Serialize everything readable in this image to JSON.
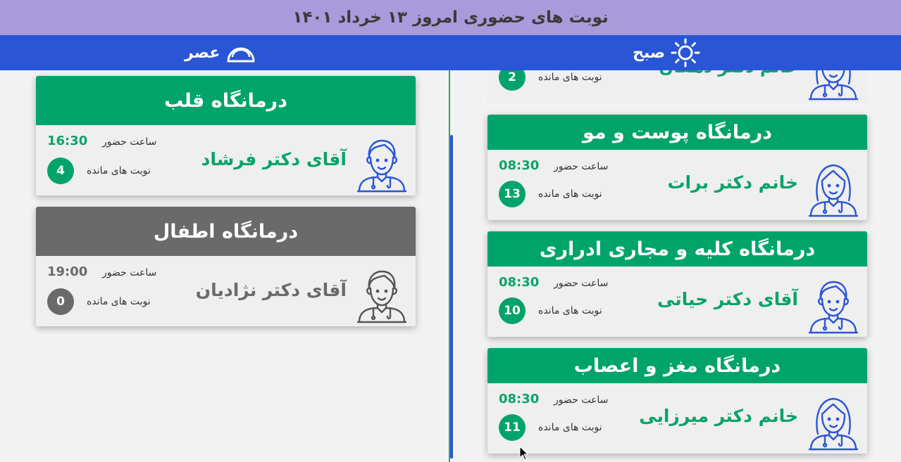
{
  "header": {
    "title": "نوبت های حضوری امروز ۱۳ خرداد ۱۴۰۱"
  },
  "shifts": {
    "morning": {
      "label": "صبح",
      "icon": "sun-icon"
    },
    "afternoon": {
      "label": "عصر",
      "icon": "sunset-icon"
    }
  },
  "labels": {
    "time": "ساعت حضور",
    "remaining": "نوبت های مانده"
  },
  "colors": {
    "active": "#00a46a",
    "inactive": "#6a6a6a",
    "header": "#a99bdb",
    "shiftbar": "#2a56d6",
    "icon": "#2a56d6"
  },
  "morning_cards": [
    {
      "clinic": "",
      "doctor": "خانم دکتر دهقان",
      "time": "",
      "remaining": "2",
      "gender": "female",
      "status": "active"
    },
    {
      "clinic": "درمانگاه پوست و مو",
      "doctor": "خانم دکتر برات",
      "time": "08:30",
      "remaining": "13",
      "gender": "female",
      "status": "active"
    },
    {
      "clinic": "درمانگاه کلیه و مجاری ادراری",
      "doctor": "آقای دکتر حیاتی",
      "time": "08:30",
      "remaining": "10",
      "gender": "male",
      "status": "active"
    },
    {
      "clinic": "درمانگاه مغز و اعصاب",
      "doctor": "خانم دکتر میرزایی",
      "time": "08:30",
      "remaining": "11",
      "gender": "female",
      "status": "active"
    }
  ],
  "afternoon_cards": [
    {
      "clinic": "درمانگاه قلب",
      "doctor": "آقای دکتر فرشاد",
      "time": "16:30",
      "remaining": "4",
      "gender": "male",
      "status": "active"
    },
    {
      "clinic": "درمانگاه اطفال",
      "doctor": "آقای دکتر نژادیان",
      "time": "19:00",
      "remaining": "0",
      "gender": "male",
      "status": "inactive"
    }
  ]
}
